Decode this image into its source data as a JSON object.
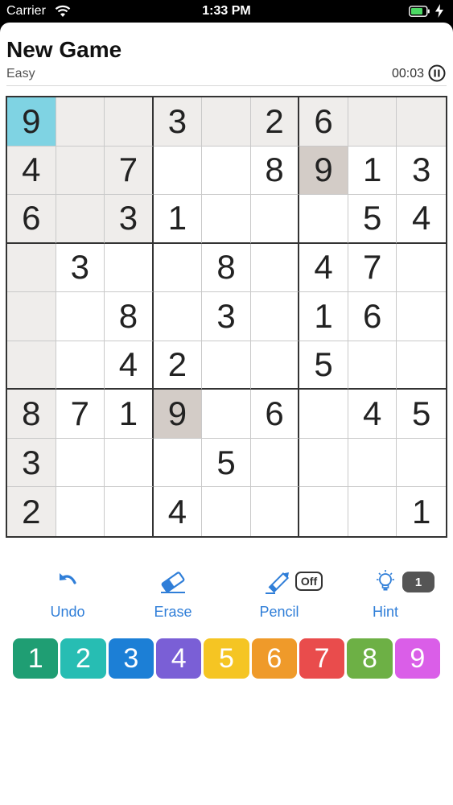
{
  "status_bar": {
    "carrier": "Carrier",
    "time": "1:33 PM"
  },
  "header": {
    "title": "New Game",
    "difficulty": "Easy",
    "timer": "00:03"
  },
  "board": {
    "grid": [
      [
        "9",
        "",
        "",
        "3",
        "",
        "2",
        "6",
        "",
        ""
      ],
      [
        "4",
        "",
        "7",
        "",
        "",
        "8",
        "9",
        "1",
        "3"
      ],
      [
        "6",
        "",
        "3",
        "1",
        "",
        "",
        "",
        "5",
        "4"
      ],
      [
        "",
        "3",
        "",
        "",
        "8",
        "",
        "4",
        "7",
        ""
      ],
      [
        "",
        "",
        "8",
        "",
        "3",
        "",
        "1",
        "6",
        ""
      ],
      [
        "",
        "",
        "4",
        "2",
        "",
        "",
        "5",
        "",
        ""
      ],
      [
        "8",
        "7",
        "1",
        "9",
        "",
        "6",
        "",
        "4",
        "5"
      ],
      [
        "3",
        "",
        "",
        "",
        "5",
        "",
        "",
        "",
        ""
      ],
      [
        "2",
        "",
        "",
        "4",
        "",
        "",
        "",
        "",
        "1"
      ]
    ],
    "selected": [
      0,
      0
    ],
    "highlight_same_value": "9",
    "colors": {
      "peer": "#efedeb",
      "same": "#d3ccc7",
      "selected": "#7fd3e3"
    }
  },
  "toolbar": {
    "undo": {
      "label": "Undo",
      "icon": "undo-arrow-icon"
    },
    "erase": {
      "label": "Erase",
      "icon": "eraser-icon"
    },
    "pencil": {
      "label": "Pencil",
      "icon": "pencil-icon",
      "badge": "Off"
    },
    "hint": {
      "label": "Hint",
      "icon": "lightbulb-icon",
      "badge": "1"
    },
    "accent_color": "#2f7ed8"
  },
  "numpad": [
    {
      "label": "1",
      "color": "#1f9e73"
    },
    {
      "label": "2",
      "color": "#27bdb3"
    },
    {
      "label": "3",
      "color": "#1c7fd6"
    },
    {
      "label": "4",
      "color": "#7a5fd6"
    },
    {
      "label": "5",
      "color": "#f5c523"
    },
    {
      "label": "6",
      "color": "#ef9a2a"
    },
    {
      "label": "7",
      "color": "#e94c4c"
    },
    {
      "label": "8",
      "color": "#6db045"
    },
    {
      "label": "9",
      "color": "#da5ee8"
    }
  ]
}
